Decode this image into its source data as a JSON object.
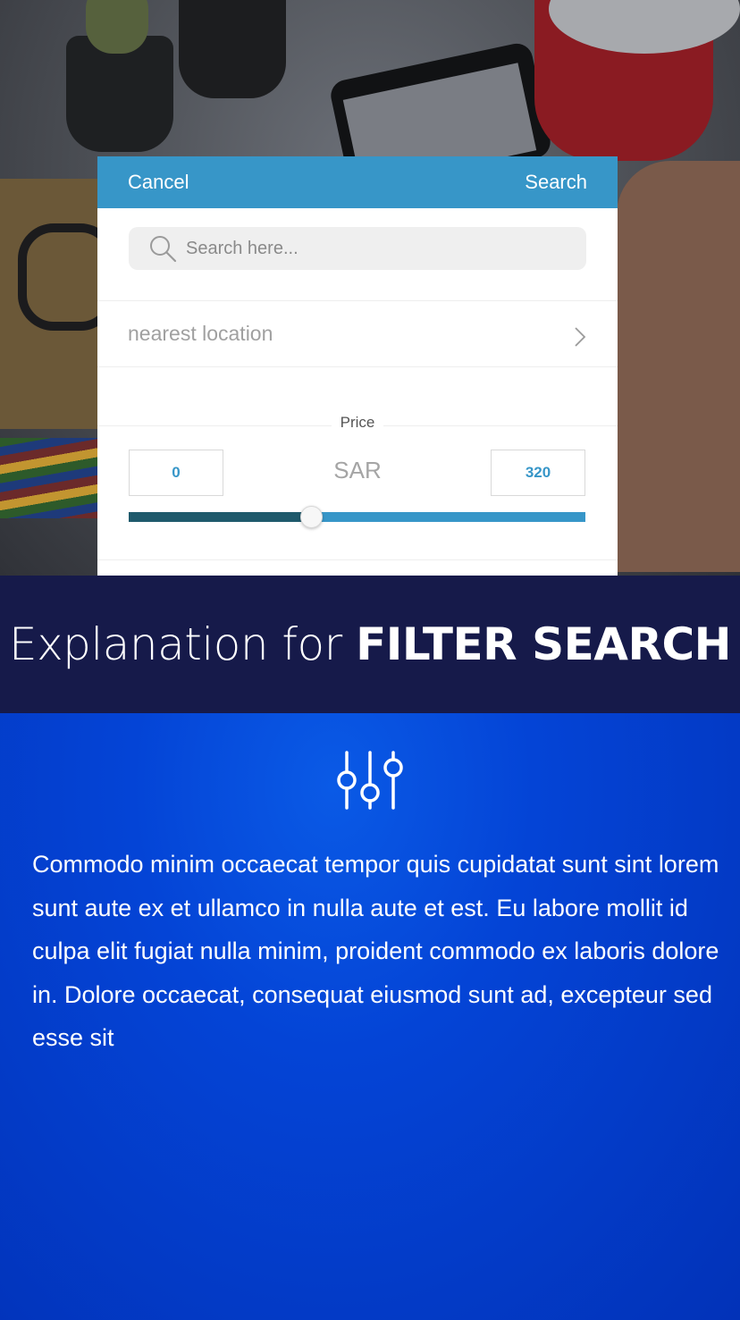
{
  "modal": {
    "cancel_label": "Cancel",
    "search_label": "Search",
    "search_placeholder": "Search here...",
    "location_label": "nearest location",
    "price_label": "Price",
    "currency": "SAR",
    "price_min": "0",
    "price_max": "320",
    "slider_fraction": 0.4
  },
  "banner": {
    "title_prefix": "Explanation for ",
    "title_emphasis": "FILTER SEARCH"
  },
  "explanation": {
    "icon": "filter-sliders-icon",
    "body": "Commodo minim occaecat tempor quis cupidatat sunt sint lorem sunt aute ex et ullamco in nulla aute et est. Eu labore mollit id culpa elit fugiat nulla minim, proident commodo ex laboris dolore in. Dolore occaecat, consequat eiusmod sunt ad, excepteur sed esse sit"
  },
  "colors": {
    "accent": "#3796c8",
    "slider_fill": "#1f5a6c",
    "banner_bg": "#161a4a",
    "explain_bg": "#0444d6"
  }
}
